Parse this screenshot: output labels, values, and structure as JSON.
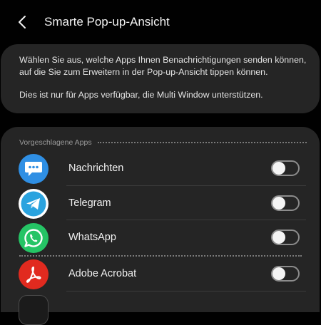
{
  "header": {
    "title": "Smarte Pop-up-Ansicht",
    "back_icon": "chevron-left-icon"
  },
  "description": {
    "line1": "Wählen Sie aus, welche Apps Ihnen Benachrichtigungen senden können,",
    "line2": "auf die Sie zum Erweitern in der Pop-up-Ansicht tippen können.",
    "line3": "Dies ist nur für Apps verfügbar, die Multi Window unterstützen."
  },
  "suggested": {
    "title": "Vorgeschlagene Apps",
    "apps": [
      {
        "name": "Nachrichten",
        "icon": "messages-icon",
        "color": "#2f8fe4",
        "enabled": false
      },
      {
        "name": "Telegram",
        "icon": "telegram-icon",
        "color": "#2aa3df",
        "enabled": false
      },
      {
        "name": "WhatsApp",
        "icon": "whatsapp-icon",
        "color": "#25c465",
        "enabled": false
      }
    ]
  },
  "other_apps": [
    {
      "name": "Adobe Acrobat",
      "icon": "adobe-acrobat-icon",
      "color": "#e12a1f",
      "enabled": false
    }
  ],
  "colors": {
    "background": "#010101",
    "card": "#252525",
    "toggle_off_border": "#8c8c8c"
  }
}
